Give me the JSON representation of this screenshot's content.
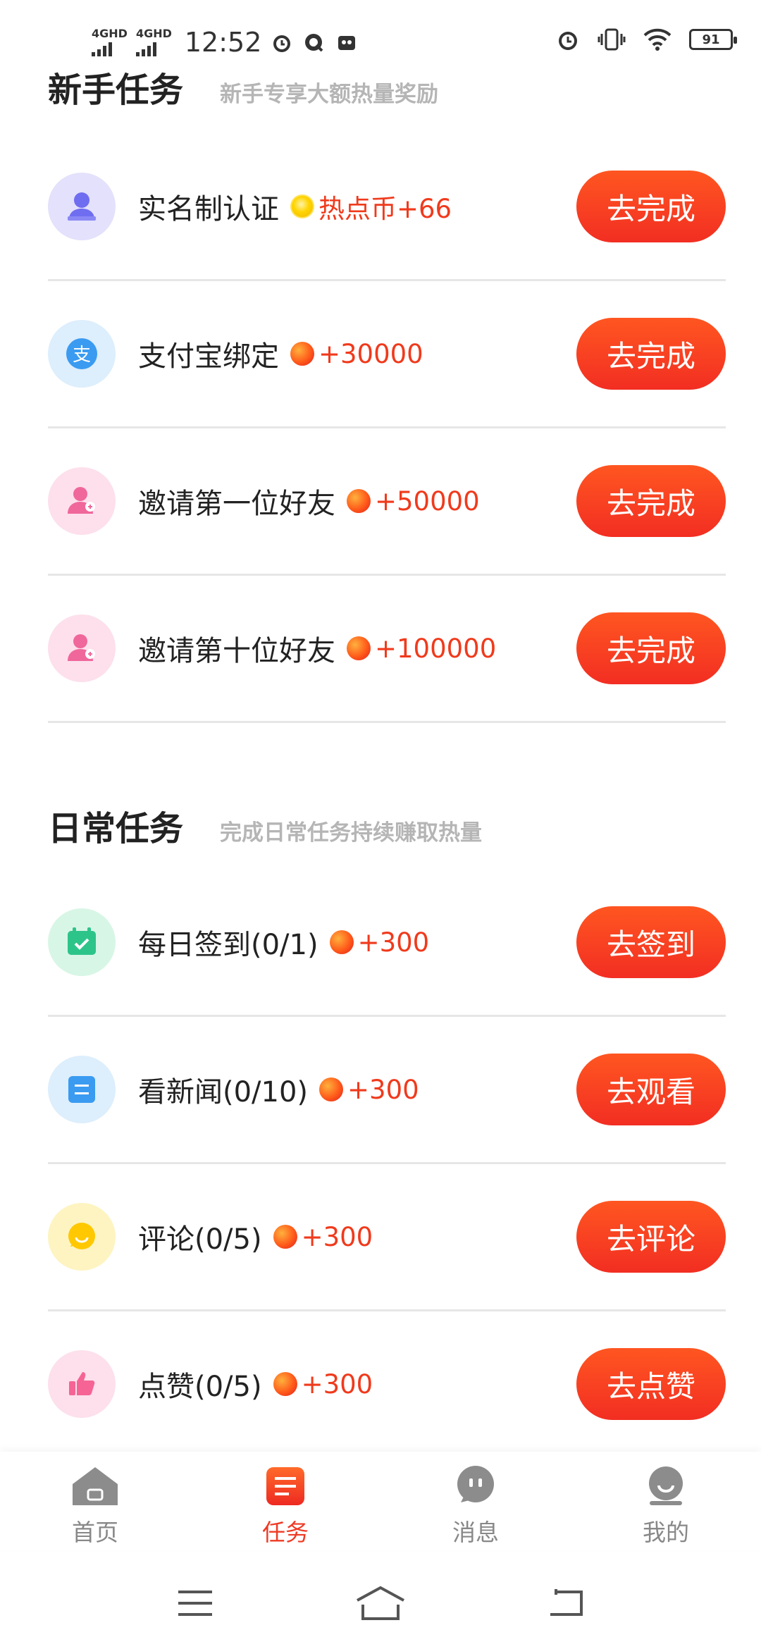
{
  "status_bar": {
    "signal1_label": "4GHD",
    "signal2_label": "4GHD",
    "time": "12:52",
    "battery": "91"
  },
  "newbie": {
    "title": "新手任务",
    "subtitle": "新手专享大额热量奖励",
    "tasks": [
      {
        "name": "实名制认证",
        "reward": "热点币+66",
        "button": "去完成",
        "icon": "person-id-icon",
        "coin": "gold"
      },
      {
        "name": "支付宝绑定",
        "reward": "+30000",
        "button": "去完成",
        "icon": "alipay-icon",
        "coin": "red"
      },
      {
        "name": "邀请第一位好友",
        "reward": "+50000",
        "button": "去完成",
        "icon": "invite-friend-icon",
        "coin": "red"
      },
      {
        "name": "邀请第十位好友",
        "reward": "+100000",
        "button": "去完成",
        "icon": "invite-friend-icon",
        "coin": "red"
      }
    ]
  },
  "daily": {
    "title": "日常任务",
    "subtitle": "完成日常任务持续赚取热量",
    "tasks": [
      {
        "name": "每日签到(0/1)",
        "reward": "+300",
        "button": "去签到",
        "icon": "calendar-check-icon"
      },
      {
        "name": "看新闻(0/10)",
        "reward": "+300",
        "button": "去观看",
        "icon": "news-icon"
      },
      {
        "name": "评论(0/5)",
        "reward": "+300",
        "button": "去评论",
        "icon": "comment-icon"
      },
      {
        "name": "点赞(0/5)",
        "reward": "+300",
        "button": "去点赞",
        "icon": "thumbs-up-icon"
      }
    ]
  },
  "bottom_nav": [
    {
      "label": "首页",
      "icon": "home-icon",
      "active": false
    },
    {
      "label": "任务",
      "icon": "task-list-icon",
      "active": true
    },
    {
      "label": "消息",
      "icon": "chat-icon",
      "active": false
    },
    {
      "label": "我的",
      "icon": "profile-icon",
      "active": false
    }
  ],
  "colors": {
    "accent": "#F22E22",
    "reward_text": "#F03A1C",
    "subtitle": "#B5B5B5"
  }
}
